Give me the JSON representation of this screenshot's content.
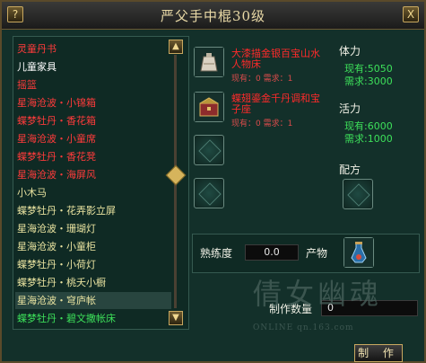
{
  "window": {
    "title": "严父手中棍30级",
    "help_label": "?",
    "close_label": "X"
  },
  "colors": {
    "unavailable": "#ff3b3b",
    "category": "#ffffff",
    "available": "#e9e3a0",
    "highlight_green": "#3de05a"
  },
  "list": {
    "items": [
      {
        "label": "灵童丹书",
        "color": "#ff3b3b"
      },
      {
        "label": "儿童家具",
        "color": "#ffffff"
      },
      {
        "label": "摇篮",
        "color": "#ff3b3b"
      },
      {
        "label": "星海沧波・小锦箱",
        "color": "#ff3b3b"
      },
      {
        "label": "蝶梦牡丹・香花箱",
        "color": "#ff3b3b"
      },
      {
        "label": "星海沧波・小童席",
        "color": "#ff3b3b"
      },
      {
        "label": "蝶梦牡丹・香花凳",
        "color": "#ff3b3b"
      },
      {
        "label": "星海沧波・海屏风",
        "color": "#ff3b3b"
      },
      {
        "label": "小木马",
        "color": "#e9e3a0"
      },
      {
        "label": "蝶梦牡丹・花弄影立屏",
        "color": "#e9e3a0"
      },
      {
        "label": "星海沧波・珊瑚灯",
        "color": "#e9e3a0"
      },
      {
        "label": "星海沧波・小童柜",
        "color": "#e9e3a0"
      },
      {
        "label": "蝶梦牡丹・小荷灯",
        "color": "#e9e3a0"
      },
      {
        "label": "蝶梦牡丹・桃夭小橱",
        "color": "#e9e3a0"
      },
      {
        "label": "星海沧波・穹庐帐",
        "color": "#e9e3a0"
      },
      {
        "label": "蝶梦牡丹・碧文撒帐床",
        "color": "#3de05a"
      }
    ],
    "selected_index": 14
  },
  "recipes": [
    {
      "name": "大漆描金银百宝山水人物床",
      "need": "现有：0 需求：1",
      "icon": "cloth-bag-icon"
    },
    {
      "name": "蝶翅鎏金千丹调和宝子座",
      "need": "现有：0 需求：1",
      "icon": "treasure-chest-icon"
    }
  ],
  "stats": {
    "stamina_label": "体力",
    "stamina_have": "现有:5050",
    "stamina_need": "需求:3000",
    "vitality_label": "活力",
    "vitality_have": "现有:6000",
    "vitality_need": "需求:1000",
    "formula_label": "配方"
  },
  "craft": {
    "proficiency_label": "熟练度",
    "proficiency_value": "0.0",
    "product_label": "产物",
    "product_icon": "potion-bottle-icon",
    "quantity_label": "制作数量",
    "quantity_value": "0",
    "make_button": "制 作"
  },
  "watermark": {
    "text": "倩女幽魂",
    "sub": "ONLINE qn.163.com"
  }
}
